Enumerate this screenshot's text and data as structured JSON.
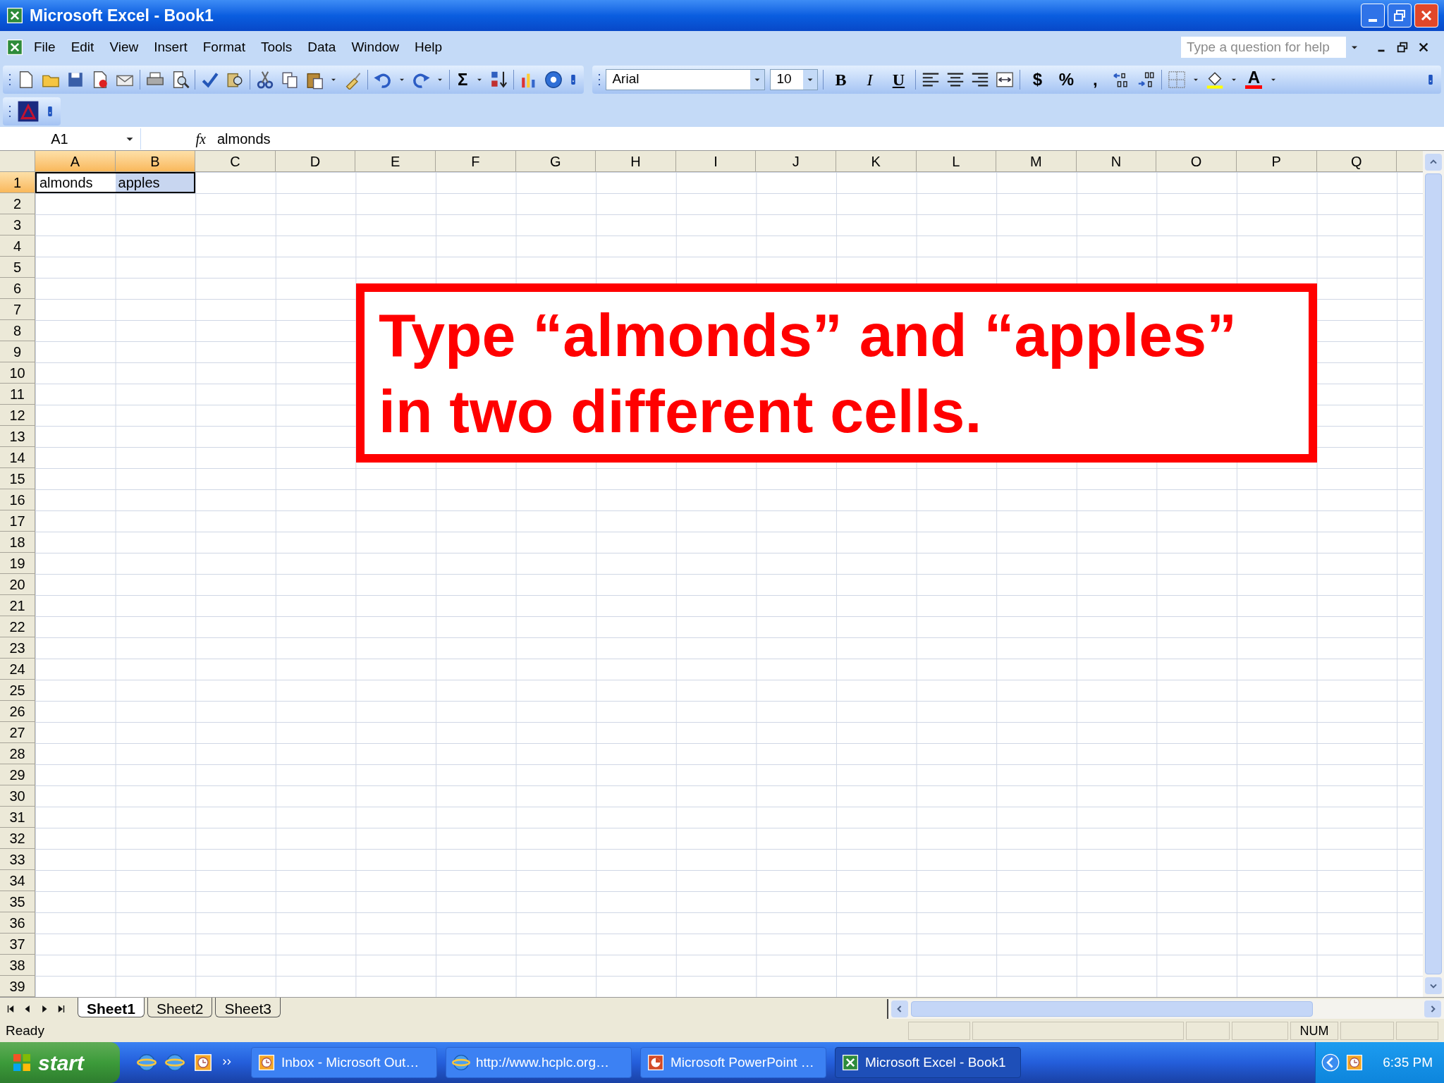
{
  "window": {
    "title": "Microsoft Excel - Book1"
  },
  "menu": [
    {
      "label": "File"
    },
    {
      "label": "Edit"
    },
    {
      "label": "View"
    },
    {
      "label": "Insert"
    },
    {
      "label": "Format"
    },
    {
      "label": "Tools"
    },
    {
      "label": "Data"
    },
    {
      "label": "Window"
    },
    {
      "label": "Help"
    }
  ],
  "help_box": {
    "placeholder": "Type a question for help"
  },
  "standard_toolbar": {
    "autosum": "Σ"
  },
  "formatting_toolbar": {
    "font": "Arial",
    "size": "10",
    "style_buttons": [
      "B",
      "I",
      "U"
    ],
    "number_buttons": [
      "$",
      "%",
      ","
    ],
    "font_color": "A"
  },
  "formula_bar": {
    "name_box": "A1",
    "fx": "fx",
    "value": "almonds"
  },
  "columns": [
    {
      "label": "A",
      "selected": true
    },
    {
      "label": "B",
      "selected": true
    },
    {
      "label": "C",
      "selected": false
    },
    {
      "label": "D",
      "selected": false
    },
    {
      "label": "E",
      "selected": false
    },
    {
      "label": "F",
      "selected": false
    },
    {
      "label": "G",
      "selected": false
    },
    {
      "label": "H",
      "selected": false
    },
    {
      "label": "I",
      "selected": false
    },
    {
      "label": "J",
      "selected": false
    },
    {
      "label": "K",
      "selected": false
    },
    {
      "label": "L",
      "selected": false
    },
    {
      "label": "M",
      "selected": false
    },
    {
      "label": "N",
      "selected": false
    },
    {
      "label": "O",
      "selected": false
    },
    {
      "label": "P",
      "selected": false
    },
    {
      "label": "Q",
      "selected": false
    }
  ],
  "rows": [
    {
      "label": "1",
      "selected": true,
      "cells": [
        {
          "text": "almonds",
          "selected": true,
          "active": true
        },
        {
          "text": "apples",
          "selected": true,
          "active": false
        }
      ]
    },
    {
      "label": "2",
      "selected": false
    },
    {
      "label": "3",
      "selected": false
    },
    {
      "label": "4",
      "selected": false
    },
    {
      "label": "5",
      "selected": false
    },
    {
      "label": "6",
      "selected": false
    },
    {
      "label": "7",
      "selected": false
    },
    {
      "label": "8",
      "selected": false
    },
    {
      "label": "9",
      "selected": false
    },
    {
      "label": "10",
      "selected": false
    },
    {
      "label": "11",
      "selected": false
    },
    {
      "label": "12",
      "selected": false
    },
    {
      "label": "13",
      "selected": false
    },
    {
      "label": "14",
      "selected": false
    },
    {
      "label": "15",
      "selected": false
    },
    {
      "label": "16",
      "selected": false
    },
    {
      "label": "17",
      "selected": false
    },
    {
      "label": "18",
      "selected": false
    },
    {
      "label": "19",
      "selected": false
    },
    {
      "label": "20",
      "selected": false
    },
    {
      "label": "21",
      "selected": false
    },
    {
      "label": "22",
      "selected": false
    },
    {
      "label": "23",
      "selected": false
    },
    {
      "label": "24",
      "selected": false
    },
    {
      "label": "25",
      "selected": false
    },
    {
      "label": "26",
      "selected": false
    },
    {
      "label": "27",
      "selected": false
    },
    {
      "label": "28",
      "selected": false
    },
    {
      "label": "29",
      "selected": false
    },
    {
      "label": "30",
      "selected": false
    },
    {
      "label": "31",
      "selected": false
    },
    {
      "label": "32",
      "selected": false
    },
    {
      "label": "33",
      "selected": false
    },
    {
      "label": "34",
      "selected": false
    },
    {
      "label": "35",
      "selected": false
    },
    {
      "label": "36",
      "selected": false
    },
    {
      "label": "37",
      "selected": false
    },
    {
      "label": "38",
      "selected": false
    },
    {
      "label": "39",
      "selected": false
    }
  ],
  "callout": {
    "text": "Type “almonds” and “apples” in two different cells."
  },
  "sheet_tabs": [
    {
      "label": "Sheet1",
      "selected": true
    },
    {
      "label": "Sheet2",
      "selected": false
    },
    {
      "label": "Sheet3",
      "selected": false
    }
  ],
  "status_bar": {
    "text": "Ready",
    "num_lock": "NUM"
  },
  "taskbar": {
    "start": "start",
    "tasks": [
      {
        "label": "Inbox - Microsoft Out…",
        "kind": "clock",
        "selected": false
      },
      {
        "label": "http://www.hcplc.org…",
        "kind": "globe",
        "selected": false
      },
      {
        "label": "Microsoft PowerPoint …",
        "kind": "slides",
        "selected": false
      },
      {
        "label": "Microsoft Excel - Book1",
        "kind": "sheet",
        "selected": true
      }
    ],
    "clock": "6:35 PM"
  }
}
